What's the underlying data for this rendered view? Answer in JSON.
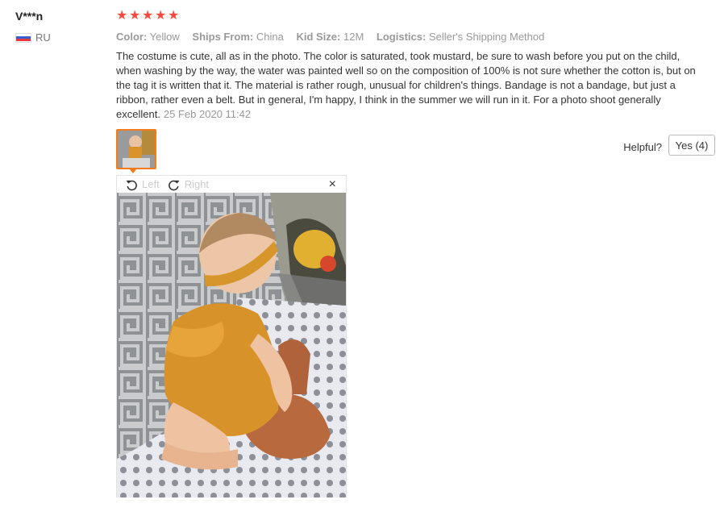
{
  "review": {
    "user": "V***n",
    "country": "RU",
    "rating": 5,
    "meta": [
      {
        "key": "Color:",
        "value": "Yellow"
      },
      {
        "key": "Ships From:",
        "value": "China"
      },
      {
        "key": "Kid Size:",
        "value": "12M"
      },
      {
        "key": "Logistics:",
        "value": "Seller's Shipping Method"
      }
    ],
    "text": "The costume is cute, all as in the photo. The color is saturated, took mustard, be sure to wash before you put on the child, when washing by the way, the water was painted well so on the composition of 100% is not sure whether the cotton is, but on the tag it is written that it. The material is rather rough, unusual for children's things. Bandage is not a bandage, but just a ribbon, rather even a belt. But in general, I'm happy, I think in the summer we will run in it. For a photo shoot generally excellent.",
    "date": "25 Feb 2020 11:42"
  },
  "helpful": {
    "label": "Helpful?",
    "yes_label": "Yes (4)"
  },
  "viewer": {
    "left_label": "Left",
    "right_label": "Right",
    "close_symbol": "×"
  },
  "colors": {
    "star": "#f44b3c",
    "thumb_border": "#f07c1e",
    "meta_text": "#999999"
  }
}
